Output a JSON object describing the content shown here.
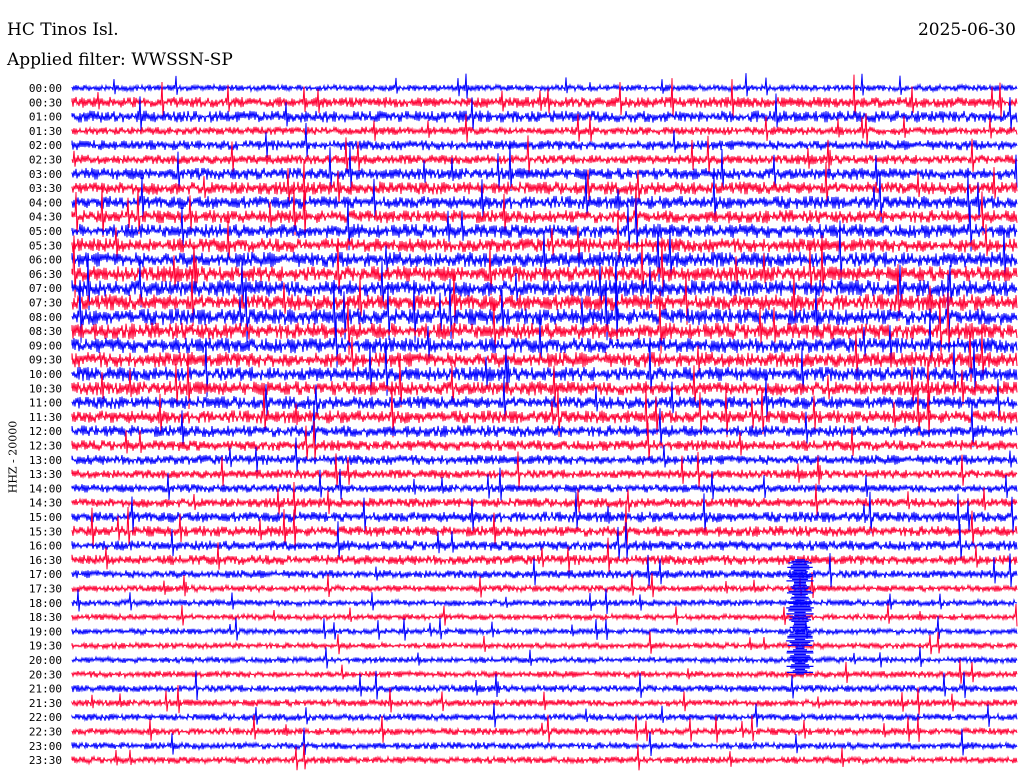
{
  "header": {
    "station": "HC Tinos Isl.",
    "filter": "Applied filter: WWSSN-SP",
    "date": "2025-06-30"
  },
  "channel_label": "HHZ - 20000",
  "colors": {
    "trace_a": "#0000ff",
    "trace_b": "#ff0033",
    "background": "#ffffff",
    "text": "#000000"
  },
  "chart_data": {
    "type": "line",
    "title": "HC Tinos Isl.",
    "subtitle": "Applied filter: WWSSN-SP",
    "ylabel": "HHZ - 20000",
    "xlabel": "",
    "grid": false,
    "legend": "none",
    "row_interval_minutes": 30,
    "tick_labels": [
      "00:00",
      "00:30",
      "01:00",
      "01:30",
      "02:00",
      "02:30",
      "03:00",
      "03:30",
      "04:00",
      "04:30",
      "05:00",
      "05:30",
      "06:00",
      "06:30",
      "07:00",
      "07:30",
      "08:00",
      "08:30",
      "09:00",
      "09:30",
      "10:00",
      "10:30",
      "11:00",
      "11:30",
      "12:00",
      "12:30",
      "13:00",
      "13:30",
      "14:00",
      "14:30",
      "15:00",
      "15:30",
      "16:00",
      "16:30",
      "17:00",
      "17:30",
      "18:00",
      "18:30",
      "19:00",
      "19:30",
      "20:00",
      "20:30",
      "21:00",
      "21:30",
      "22:00",
      "22:30",
      "23:00",
      "23:30"
    ],
    "trace_color_order": [
      "blue",
      "red"
    ],
    "relative_amplitude": [
      0.55,
      0.9,
      1.0,
      0.7,
      0.85,
      0.8,
      1.0,
      1.1,
      1.1,
      1.1,
      1.2,
      1.2,
      1.3,
      1.3,
      1.4,
      1.4,
      1.4,
      1.4,
      1.3,
      1.3,
      1.2,
      1.2,
      1.1,
      1.1,
      1.0,
      0.9,
      0.85,
      0.75,
      0.7,
      0.8,
      0.9,
      0.9,
      0.85,
      0.85,
      0.7,
      0.55,
      0.55,
      0.5,
      0.5,
      0.5,
      0.5,
      0.55,
      0.6,
      0.6,
      0.6,
      0.6,
      0.6,
      0.6
    ],
    "events": [
      {
        "label": "16:30",
        "note": "large transient",
        "row_start": 33,
        "row_end": 41
      }
    ]
  }
}
